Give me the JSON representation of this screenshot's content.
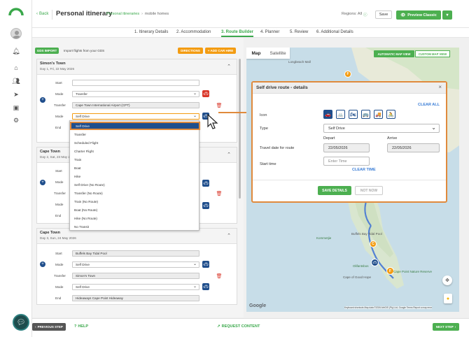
{
  "header": {
    "back_label": "Back",
    "title": "Personal itinerary",
    "breadcrumb_parent": "Personal itineraries",
    "breadcrumb_current": "mobile homes",
    "breadcrumb_sep": "›",
    "regions_label": "Regions: All",
    "save_label": "Save",
    "preview_label": "Preview Classic"
  },
  "tabs": [
    {
      "label": "1. Itinerary Details"
    },
    {
      "label": "2. Accommodation"
    },
    {
      "label": "3. Route Builder"
    },
    {
      "label": "4. Planner"
    },
    {
      "label": "5. Review"
    },
    {
      "label": "6. Additional Details"
    }
  ],
  "toolbar": {
    "gds_label": "GDS IMPORT",
    "gds_text": "Import flights from your GDS",
    "directions_label": "DIRECTIONS",
    "add_car_label": "+ ADD CAR HIRE"
  },
  "cards": [
    {
      "title": "Simon's Town",
      "date": "Day 1, Fri, 22 May 2026",
      "rows": {
        "start_label": "Start",
        "mode_label": "Mode",
        "mode_value": "Transfer",
        "transfer_label": "Transfer",
        "transfer_value": "Cape Town International Airport (CPT)",
        "mode2_label": "Mode",
        "mode2_value": "Self Drive",
        "end_label": "End"
      }
    },
    {
      "title": "Cape Town",
      "date": "Day 2, Sat, 23 May 2026",
      "rows": {
        "start_label": "Start",
        "mode_label": "Mode",
        "transfer_label": "Transfer",
        "mode2_label": "Mode",
        "end_label": "End"
      }
    },
    {
      "title": "Cape Town",
      "date": "Day 3, Sun, 24 May 2026",
      "rows": {
        "start_label": "Start",
        "start_value": "Buffels Bay Tidal Pool",
        "mode_label": "Mode",
        "mode_value": "Self Drive",
        "transfer_label": "Transfer",
        "transfer_value": "Simon's Town",
        "mode2_label": "Mode",
        "mode2_value": "Self Drive",
        "end_label": "End",
        "end_value": "Hideaways Cape Point Hideaway"
      }
    }
  ],
  "dropdown": {
    "options": [
      "Self Drive",
      "Transfer",
      "Scheduled Flight",
      "Charter Flight",
      "Train",
      "Boat",
      "Hike",
      "Self Drive (No Route)",
      "Transfer (No Route)",
      "Train (No Route)",
      "Boat (No Route)",
      "Hike (No Route)",
      "No Transit"
    ],
    "selected_index": 0
  },
  "map": {
    "tab_map": "Map",
    "tab_satellite": "Satellite",
    "auto_view_label": "AUTOMATIC MAP VIEW",
    "custom_view_label": "CUSTOM MAP VIEW",
    "place_longbeach": "Longbeach Mall",
    "place_kommetjie": "Kommetjie",
    "place_buffels": "Buffels Bay Tidal Pool",
    "place_olifants": "Olifantsbos",
    "place_capepoint": "Cape of Good Hope",
    "place_reserve": "Cape Point Nature Reserve",
    "google_label": "Google",
    "attribution": "Keyboard shortcuts   Map data ©2026 AfriGIS (Pty) Ltd, Google   Terms   Report a map error",
    "marker_letters": [
      "F",
      "C",
      "F"
    ],
    "route_color": "#3b6fd6"
  },
  "modal": {
    "title": "Self drive route - details",
    "clear_all": "CLEAR ALL",
    "icon_label": "Icon",
    "icons": [
      "car-icon",
      "cycle-icon",
      "motorbike-icon",
      "bus-icon",
      "truck-icon",
      "bicycle-icon"
    ],
    "icon_glyphs": [
      "🚗",
      "🚲",
      "🏍",
      "🚌",
      "🚚",
      "🚴"
    ],
    "type_label": "Type",
    "type_value": "Self Drive",
    "depart_label": "Depart",
    "arrive_label": "Arrive",
    "travel_date_label": "Travel date for route",
    "depart_value": "22/05/2026",
    "arrive_value": "22/05/2026",
    "start_time_label": "Start time",
    "enter_time_placeholder": "Enter Time",
    "clear_time": "CLEAR TIME",
    "save_details": "SAVE DETAILS",
    "not_now": "NOT NOW"
  },
  "footer": {
    "previous_step": "PREVIOUS STEP",
    "help": "HELP",
    "request_content": "REQUEST CONTENT",
    "next_step": "NEXT STEP"
  },
  "colors": {
    "accent_green": "#4caf50",
    "accent_orange": "#f39c12",
    "navy": "#1f4e8c",
    "highlight_border": "#e08a3c"
  }
}
